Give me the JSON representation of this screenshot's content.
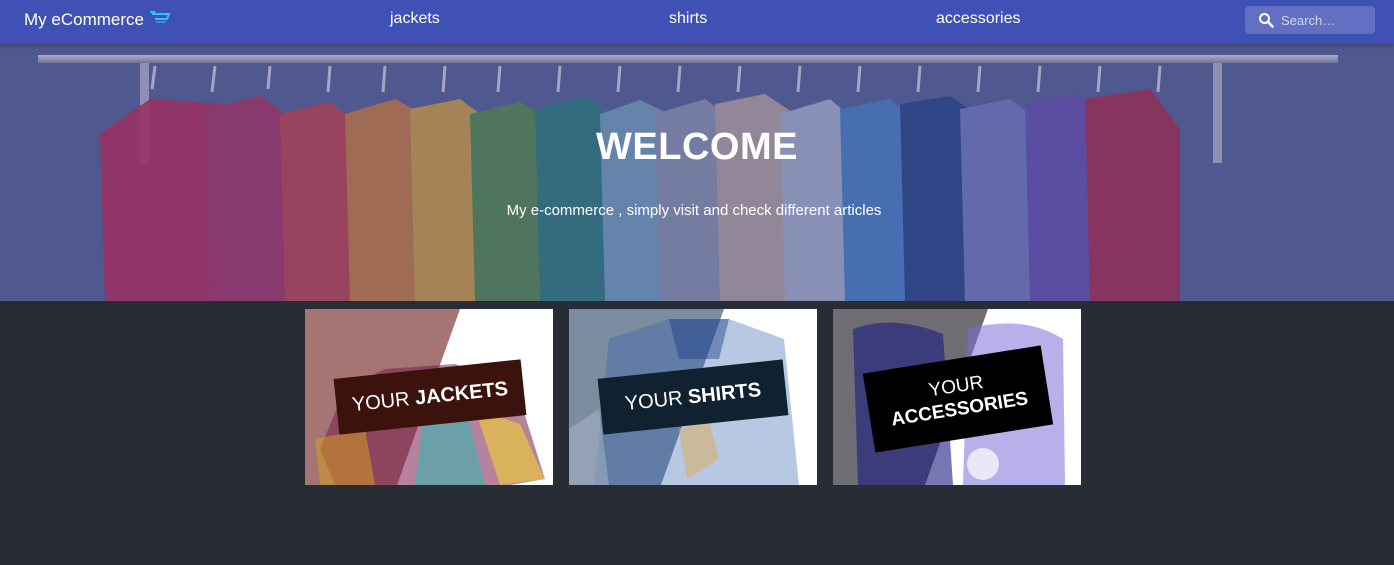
{
  "navbar": {
    "brand": "My eCommerce",
    "brand_icon": "shopping-cart-icon",
    "links": [
      "jackets",
      "shirts",
      "accessories"
    ],
    "search_placeholder": "Search…",
    "background": "#3f51b5"
  },
  "hero": {
    "title": "WELCOME",
    "subtitle": "My e-commerce , simply visit and check different articles"
  },
  "cards": [
    {
      "light": "YOUR",
      "bold": "JACKETS",
      "banner_color": "#3b120c"
    },
    {
      "light": "YOUR",
      "bold": "SHIRTS",
      "banner_color": "#102230"
    },
    {
      "light": "YOUR",
      "bold": "ACCESSORIES",
      "banner_color": "#000000"
    }
  ],
  "page_background": "#282c34"
}
